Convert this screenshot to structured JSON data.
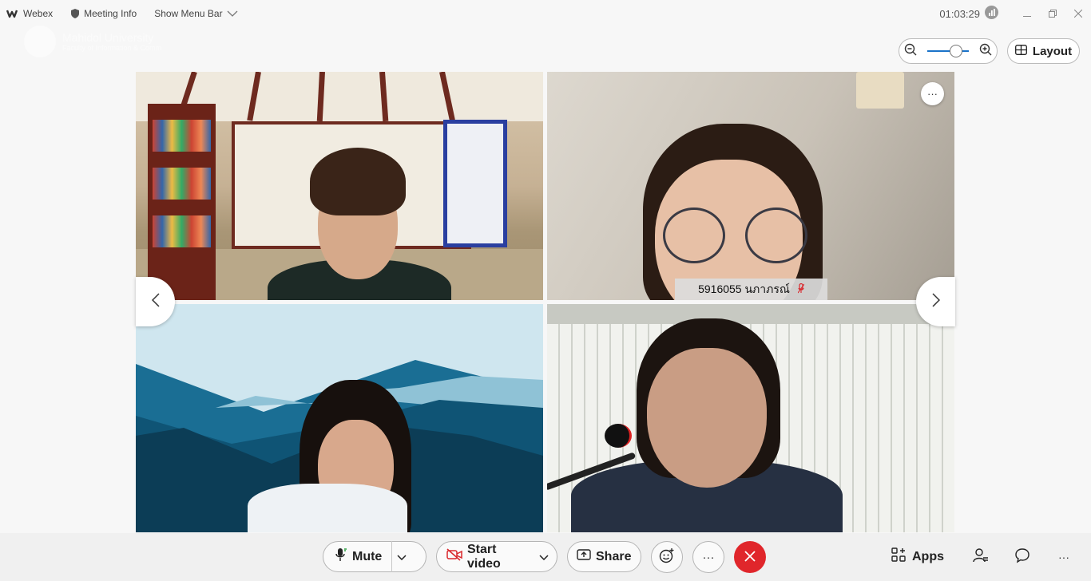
{
  "titlebar": {
    "app_name": "Webex",
    "meeting_info": "Meeting Info",
    "show_menu_bar": "Show Menu Bar",
    "timer": "01:03:29"
  },
  "watermark": {
    "line1": "Mahidol University",
    "line2": "Faculty of Information & Comm"
  },
  "toolbar_top": {
    "layout_label": "Layout",
    "zoom_level": 0.6
  },
  "participants": [
    {
      "tile": "top-left",
      "name": "",
      "muted": false
    },
    {
      "tile": "top-right",
      "name": "5916055 นภาภรณ์",
      "muted": true
    },
    {
      "tile": "bottom-left",
      "name": "",
      "muted": false
    },
    {
      "tile": "bottom-right",
      "name": "",
      "muted": false
    }
  ],
  "bottombar": {
    "mute_label": "Mute",
    "video_label": "Start video",
    "share_label": "Share",
    "apps_label": "Apps",
    "more_glyph": "···",
    "overflow_glyph": "···"
  },
  "colors": {
    "leave_red": "#e0262b",
    "accent_blue": "#1a73c9",
    "video_off_red": "#d9262b"
  }
}
